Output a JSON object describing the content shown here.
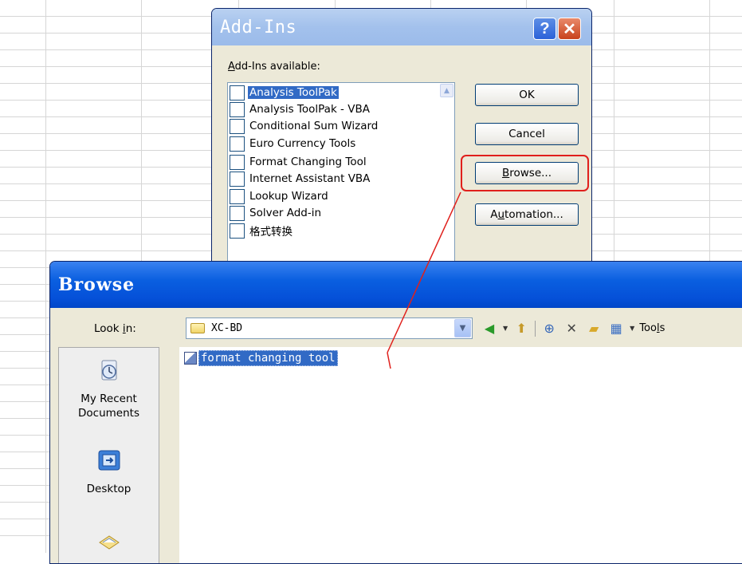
{
  "addins_dialog": {
    "title": "Add-Ins",
    "available_label_prefix": "A",
    "available_label_rest": "dd-Ins available:",
    "items": [
      {
        "label": "Analysis ToolPak",
        "checked": false,
        "selected": true
      },
      {
        "label": "Analysis ToolPak - VBA",
        "checked": false,
        "selected": false
      },
      {
        "label": "Conditional Sum Wizard",
        "checked": false,
        "selected": false
      },
      {
        "label": "Euro Currency Tools",
        "checked": false,
        "selected": false
      },
      {
        "label": "Format Changing Tool",
        "checked": false,
        "selected": false
      },
      {
        "label": "Internet Assistant VBA",
        "checked": false,
        "selected": false
      },
      {
        "label": "Lookup Wizard",
        "checked": false,
        "selected": false
      },
      {
        "label": "Solver Add-in",
        "checked": false,
        "selected": false
      },
      {
        "label": "格式转换",
        "checked": false,
        "selected": false
      }
    ],
    "ok_label": "OK",
    "cancel_label": "Cancel",
    "browse_label_accel": "B",
    "browse_label_rest": "rowse...",
    "automation_label_pre": "A",
    "automation_label_accel": "u",
    "automation_label_rest": "tomation...",
    "help_glyph": "?",
    "close_glyph": "✕"
  },
  "browse_dialog": {
    "title": "Browse",
    "lookin_label_pre": "Look ",
    "lookin_label_accel": "i",
    "lookin_label_rest": "n:",
    "lookin_value": "XC-BD",
    "tools_label_pre": "Too",
    "tools_label_accel": "l",
    "tools_label_rest": "s",
    "places": [
      {
        "line1": "My Recent",
        "line2": "Documents",
        "icon": "recent-documents-icon"
      },
      {
        "line1": "Desktop",
        "line2": "",
        "icon": "desktop-icon"
      }
    ],
    "files": [
      {
        "name": "format changing tool",
        "icon": "excel-addin-file-icon",
        "selected": true
      }
    ]
  },
  "colors": {
    "highlight": "#e0201c",
    "selection": "#316ac5",
    "dialog_face": "#ece9d8"
  }
}
